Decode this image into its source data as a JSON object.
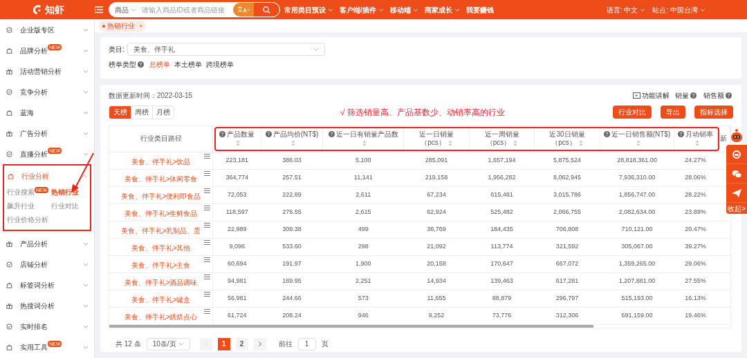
{
  "header": {
    "logo": "知虾",
    "search": {
      "scope": "商品",
      "placeholder": "请输入商品ID或者商品链接"
    },
    "nav": [
      {
        "label": "常用类目预设",
        "caret": true
      },
      {
        "label": "客户端/插件",
        "caret": true
      },
      {
        "label": "移动端",
        "caret": true
      },
      {
        "label": "商家成长",
        "caret": true
      },
      {
        "label": "我要赚钱",
        "caret": false
      }
    ],
    "language": "语言: 中文",
    "site": "站点: 中国台湾"
  },
  "sidebar": {
    "items": [
      {
        "label": "企业版专区",
        "expanded": false
      },
      {
        "label": "品牌分析",
        "badge": "NEW",
        "expanded": false
      },
      {
        "label": "活动营销分析",
        "expanded": false
      },
      {
        "label": "竞争分析",
        "expanded": false
      },
      {
        "label": "蓝海",
        "expanded": false
      },
      {
        "label": "广告分析",
        "expanded": false
      },
      {
        "label": "直播分析",
        "badge": "NEW",
        "expanded": false
      },
      {
        "label": "行业分析",
        "expanded": true,
        "children": [
          {
            "label": "行业搜索",
            "badge": "NEW",
            "selected": false
          },
          {
            "label": "热销行业",
            "selected": true
          },
          {
            "label": "飙升行业",
            "selected": false
          },
          {
            "label": "行业对比",
            "selected": false
          },
          {
            "label": "行业价格分析",
            "selected": false
          }
        ]
      },
      {
        "label": "产品分析",
        "expanded": false
      },
      {
        "label": "店铺分析",
        "expanded": false
      },
      {
        "label": "标签词分析",
        "expanded": false
      },
      {
        "label": "热搜词分析",
        "expanded": false
      },
      {
        "label": "实时排名",
        "expanded": false
      },
      {
        "label": "实用工具",
        "badge": "NEW",
        "expanded": false
      }
    ]
  },
  "page_tab": {
    "label": "热销行业"
  },
  "filter": {
    "category_label": "类目:",
    "category_value": "美食、伴手礼",
    "list_type_label": "榜单类型",
    "list_types": [
      {
        "label": "总榜单",
        "selected": true
      },
      {
        "label": "本土榜单",
        "selected": false
      },
      {
        "label": "跨境榜单",
        "selected": false
      }
    ]
  },
  "update_time": "数据更新时间：2022-03-15",
  "links": [
    {
      "label": "功能讲解",
      "kind": "guide"
    },
    {
      "label": "销量",
      "kind": "help"
    },
    {
      "label": "销售额",
      "kind": "help"
    }
  ],
  "period_tabs": [
    {
      "label": "天榜",
      "selected": true
    },
    {
      "label": "周榜",
      "selected": false
    },
    {
      "label": "月榜",
      "selected": false
    }
  ],
  "annotation": "√ 筛选销量高、产品基数少、动销率高的行业",
  "buttons": [
    "行业对比",
    "导出",
    "指标选择"
  ],
  "table": {
    "columns": [
      {
        "label": "行业类目路径",
        "help": false,
        "sortable": false
      },
      {
        "label": "产品数量",
        "help": true,
        "sortable": true
      },
      {
        "label": "产品均价(NT$)",
        "help": true,
        "sortable": true
      },
      {
        "label": "近一日有销量产品数",
        "help": true,
        "sortable": true
      },
      {
        "label": "近一日销量（pcs）",
        "help": false,
        "sortable": true
      },
      {
        "label": "近一周销量（pcs）",
        "help": false,
        "sortable": true
      },
      {
        "label": "近30日销量（pcs）",
        "help": false,
        "sortable": true
      },
      {
        "label": "近一日销售额(NT$)",
        "help": true,
        "sortable": true
      },
      {
        "label": "月动销率",
        "help": true,
        "sortable": true
      },
      {
        "label": "新",
        "help": false,
        "sortable": false
      }
    ],
    "rows": [
      [
        "美食、伴手礼>饮品",
        "223,181",
        "386.03",
        "5,100",
        "285,091",
        "1,657,194",
        "5,875,524",
        "28,818,361.00",
        "24.27%"
      ],
      [
        "美食、伴手礼>休闲零食",
        "364,774",
        "257.51",
        "11,141",
        "219,158",
        "1,956,282",
        "8,062,945",
        "7,936,310.00",
        "28.06%"
      ],
      [
        "美食、伴手礼>便利即食品",
        "72,053",
        "222.89",
        "2,611",
        "67,234",
        "615,481",
        "3,015,786",
        "1,856,747.00",
        "28.22%"
      ],
      [
        "美食、伴手礼>生鲜食品",
        "118,597",
        "276.55",
        "2,615",
        "62,924",
        "525,482",
        "2,066,755",
        "2,082,634.00",
        "23.89%"
      ],
      [
        "美食、伴手礼>乳制品、蛋",
        "22,989",
        "309.38",
        "499",
        "38,769",
        "184,435",
        "706,808",
        "710,121.00",
        "20.47%"
      ],
      [
        "美食、伴手礼>其他",
        "9,096",
        "533.60",
        "298",
        "21,092",
        "113,774",
        "321,592",
        "305,067.00",
        "39.27%"
      ],
      [
        "美食、伴手礼>主食",
        "60,694",
        "191.97",
        "1,900",
        "20,158",
        "170,647",
        "667,072",
        "1,359,265.00",
        "29.06%"
      ],
      [
        "美食、伴手礼>酒品调味",
        "94,981",
        "189.95",
        "2,251",
        "14,934",
        "139,463",
        "617,281",
        "1,207,881.00",
        "27.55%"
      ],
      [
        "美食、伴手礼>罐盒",
        "56,981",
        "244.66",
        "573",
        "11,655",
        "88,879",
        "296,797",
        "515,193.00",
        "16.13%"
      ],
      [
        "美食、伴手礼>烘焙点心",
        "61,724",
        "208.24",
        "946",
        "9,252",
        "73,776",
        "312,306",
        "691,159.00",
        "19.46%"
      ]
    ]
  },
  "pagination": {
    "total": "共 12 条",
    "page_size": "10条/页",
    "pages": [
      {
        "label": "1",
        "selected": true
      },
      {
        "label": "2",
        "selected": false
      }
    ],
    "goto_label": "前往",
    "goto_value": "1",
    "goto_unit": "页"
  },
  "float_panel": {
    "collapse": "收起>"
  }
}
